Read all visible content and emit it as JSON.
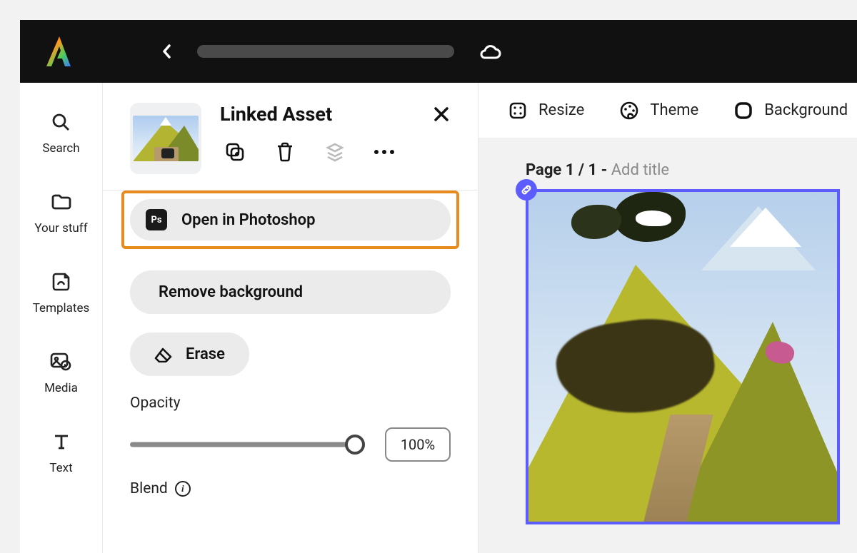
{
  "rail": {
    "search": "Search",
    "your_stuff": "Your stuff",
    "templates": "Templates",
    "media": "Media",
    "text": "Text"
  },
  "panel": {
    "title": "Linked Asset",
    "open_ps": "Open in Photoshop",
    "ps_badge": "Ps",
    "remove_bg": "Remove background",
    "erase": "Erase",
    "opacity_label": "Opacity",
    "opacity_value": "100%",
    "blend_label": "Blend"
  },
  "toolbar": {
    "resize": "Resize",
    "theme": "Theme",
    "background": "Background"
  },
  "canvas": {
    "page_prefix": "Page 1 / 1 - ",
    "page_placeholder": "Add title"
  }
}
